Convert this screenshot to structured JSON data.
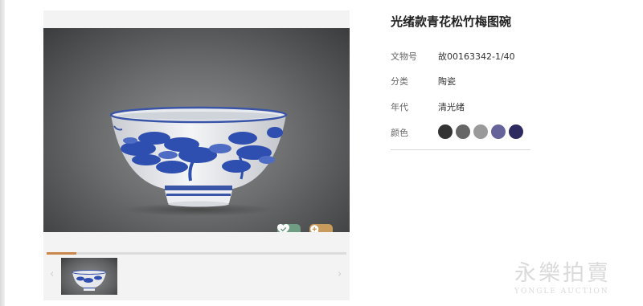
{
  "product": {
    "title": "光绪款青花松竹梅图碗",
    "specs": [
      {
        "label": "文物号",
        "value": "故00163342-1/40"
      },
      {
        "label": "分类",
        "value": "陶瓷"
      },
      {
        "label": "年代",
        "value": "清光绪"
      }
    ],
    "color_label": "颜色",
    "colors": [
      {
        "name": "black",
        "hex": "#333333"
      },
      {
        "name": "dark-gray",
        "hex": "#666666"
      },
      {
        "name": "light-gray",
        "hex": "#9a9a9a"
      },
      {
        "name": "purple-blue",
        "hex": "#65639a"
      },
      {
        "name": "navy",
        "hex": "#2d2a60"
      }
    ]
  },
  "gallery": {
    "fav_icon": "heart-check-icon",
    "zoom_icon": "zoom-in-icon",
    "prev_glyph": "‹",
    "next_glyph": "›",
    "progress_fraction": 0.1,
    "progress_color": "#c9874b"
  },
  "branding": {
    "logo_main": "永樂拍賣",
    "logo_sub": "YONGLE AUCTION"
  }
}
